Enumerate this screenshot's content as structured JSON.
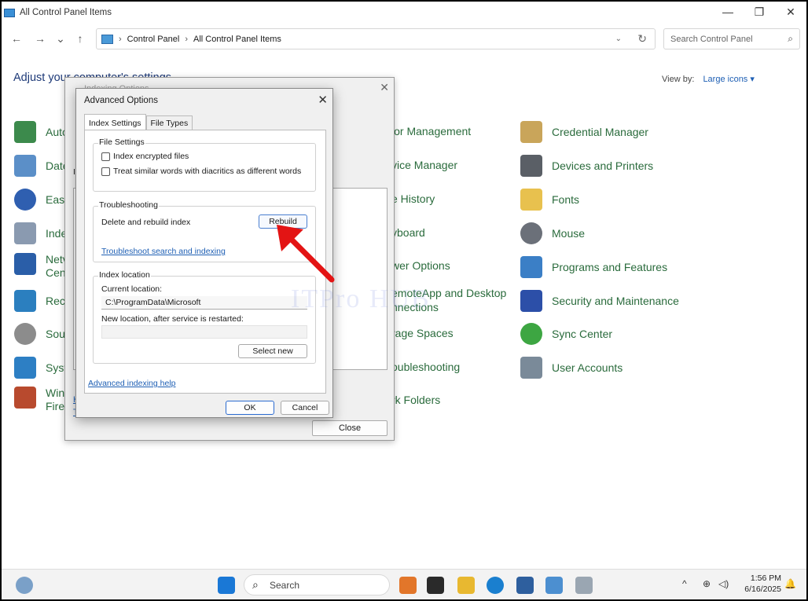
{
  "window": {
    "title": "All Control Panel Items",
    "minimize": "—",
    "maximize": "❐",
    "close": "✕"
  },
  "nav": {
    "back": "←",
    "forward": "→",
    "recent": "⌄",
    "up": "↑"
  },
  "address": {
    "crumbs": [
      "Control Panel",
      "All Control Panel Items"
    ],
    "separator": "›",
    "dropdown": "⌄",
    "refresh": "↻"
  },
  "search": {
    "placeholder": "Search Control Panel",
    "icon": "⌕"
  },
  "heading": "Adjust your computer's settings",
  "view_by": {
    "label": "View by:",
    "value": "Large icons ▾"
  },
  "items": {
    "left": [
      "Auto",
      "Date",
      "Ease",
      "Inde",
      "Netv",
      "Cent",
      "Reco",
      "Sour",
      "Syst",
      "Winc",
      "Firev"
    ],
    "middle": [
      "lor Management",
      "vice Manager",
      "e History",
      "yboard",
      "wer Options",
      "emoteApp and Desktop",
      "nnections",
      "rage Spaces",
      "oubleshooting",
      "rk Folders"
    ],
    "right": [
      "Credential Manager",
      "Devices and Printers",
      "Fonts",
      "Mouse",
      "Programs and Features",
      "Security and Maintenance",
      "Sync Center",
      "User Accounts"
    ]
  },
  "indexing_dialog": {
    "title": "Indexing Options",
    "partial_label": "Ir",
    "links": [
      "H",
      "T"
    ],
    "close_label": "Close"
  },
  "advanced": {
    "title": "Advanced Options",
    "tabs": [
      "Index Settings",
      "File Types"
    ],
    "file_settings": {
      "title": "File Settings",
      "options": [
        "Index encrypted files",
        "Treat similar words with diacritics as different words"
      ]
    },
    "troubleshooting": {
      "title": "Troubleshooting",
      "label": "Delete and rebuild index",
      "button": "Rebuild",
      "link": "Troubleshoot search and indexing"
    },
    "index_location": {
      "title": "Index location",
      "current_label": "Current location:",
      "current_value": "C:\\ProgramData\\Microsoft",
      "new_label": "New location, after service is restarted:",
      "new_value": "",
      "select_button": "Select new"
    },
    "help_link": "Advanced indexing help",
    "ok": "OK",
    "cancel": "Cancel"
  },
  "taskbar": {
    "search": "Search",
    "time": "1:56 PM",
    "date": "6/16/2025",
    "tray_chevron": "^"
  },
  "watermark": "ITPro HUB",
  "colors": {
    "link": "#1e5fb4",
    "item_text": "#2a6b3c",
    "arrow": "#e31414"
  }
}
